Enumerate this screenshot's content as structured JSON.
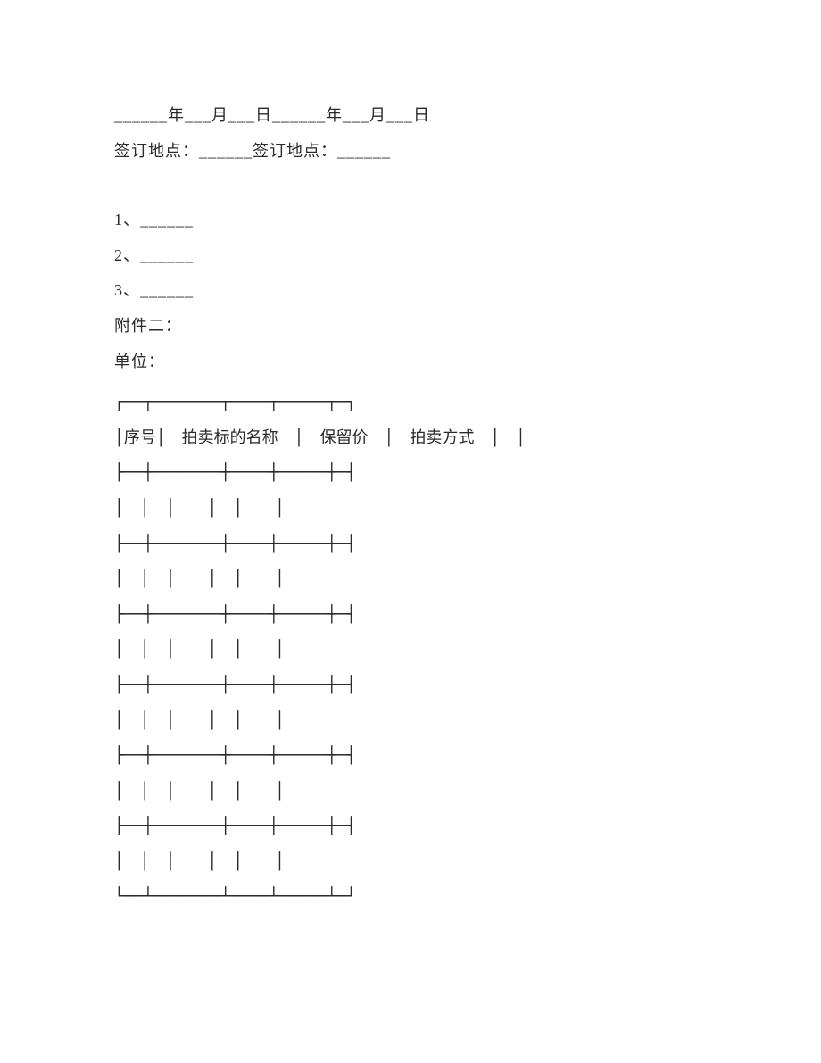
{
  "lines": {
    "date_line": "______年___月___日______年___月___日",
    "location_line": "签订地点：______签订地点：______",
    "item1": "1、______",
    "item2": "2、______",
    "item3": "3、______",
    "attachment": "附件二：",
    "unit": "单位："
  },
  "table": {
    "top_border": "┌──┬───────┬────┬─────┬─┐",
    "header_row": "│序号│　拍卖标的名称　│　保留价　│　拍卖方式　│　│",
    "row_separator": "├──┼───────┼────┼─────┼─┤",
    "empty_row": "│　│　│　　│　│　　│",
    "bottom_border": "└──┴───────┴────┴─────┴─┘"
  }
}
